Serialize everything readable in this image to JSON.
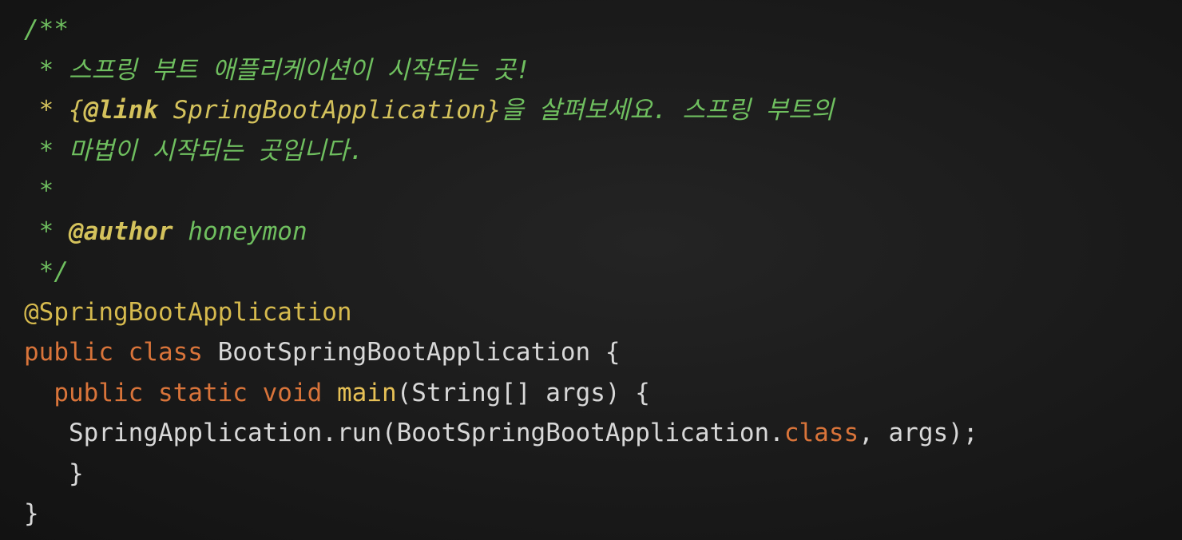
{
  "code": {
    "doc_open": "/**",
    "doc_line1": " * 스프링 부트 애플리케이션이 시작되는 곳!",
    "doc_line2_prefix": " * {",
    "doc_line2_tag": "@link",
    "doc_line2_ref": " SpringBootApplication}",
    "doc_line2_rest": "을 살펴보세요. 스프링 부트의",
    "doc_line3": " * 마법이 시작되는 곳입니다.",
    "doc_line4": " *",
    "doc_author_prefix": " * ",
    "doc_author_tag": "@author",
    "doc_author_name": " honeymon",
    "doc_close": " */",
    "annotation": "@SpringBootApplication",
    "class_kw_public": "public",
    "class_kw_class": " class",
    "class_name": " BootSpringBootApplication {",
    "main_indent": "  ",
    "main_kw_public": "public",
    "main_kw_static": " static",
    "main_kw_void": " void",
    "main_name": " main",
    "main_params": "(String[] args) {",
    "run_call": "   SpringApplication.run(BootSpringBootApplication.",
    "run_kw_class": "class",
    "run_args": ", args);",
    "close_method": "   }",
    "close_class": "}"
  },
  "colors": {
    "comment": "#6fbf5f",
    "javadoc_tag": "#d4c25c",
    "annotation": "#d6ba4e",
    "keyword": "#d9743a",
    "method": "#e6c056",
    "plain": "#d8d8d8",
    "background": "#1a1a1a"
  }
}
